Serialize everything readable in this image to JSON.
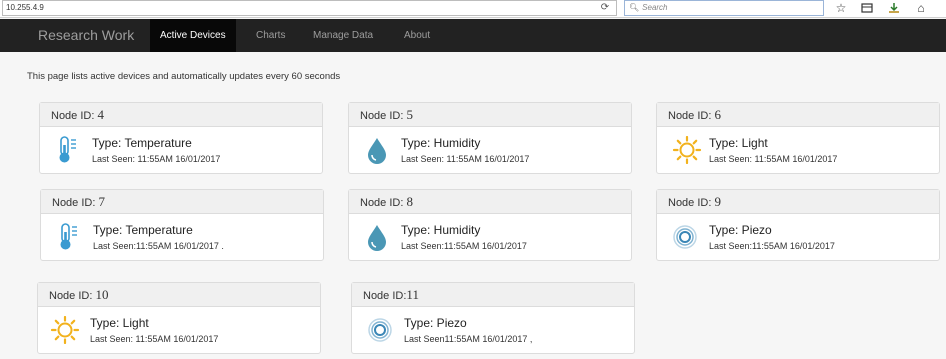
{
  "browser": {
    "url": "10.255.4.9",
    "search_placeholder": "Search"
  },
  "nav": {
    "brand": "Research Work",
    "items": [
      {
        "label": "Active Devices",
        "active": true
      },
      {
        "label": "Charts",
        "active": false
      },
      {
        "label": "Manage Data",
        "active": false
      },
      {
        "label": "About",
        "active": false
      }
    ]
  },
  "intro": "This page lists active devices and automatically updates every 60 seconds",
  "devices": [
    {
      "node_label": "Node ID:",
      "node_id": "4",
      "type": "Type: Temperature",
      "last_seen": "Last Seen: 11:55AM 16/01/2017",
      "icon": "thermometer-icon"
    },
    {
      "node_label": "Node ID:",
      "node_id": "5",
      "type": "Type: Humidity",
      "last_seen": "Last Seen: 11:55AM 16/01/2017",
      "icon": "water-drop-icon"
    },
    {
      "node_label": "Node ID:",
      "node_id": "6",
      "type": "Type: Light",
      "last_seen": "Last Seen: 11:55AM 16/01/2017",
      "icon": "sun-icon"
    },
    {
      "node_label": "Node ID:",
      "node_id": "7",
      "type": "Type: Temperature",
      "last_seen": "Last Seen:11:55AM 16/01/2017 .",
      "icon": "thermometer-icon"
    },
    {
      "node_label": "Node ID:",
      "node_id": "8",
      "type": "Type: Humidity",
      "last_seen": "Last Seen:11:55AM 16/01/2017",
      "icon": "water-drop-icon"
    },
    {
      "node_label": "Node ID:",
      "node_id": "9",
      "type": "Type: Piezo",
      "last_seen": "Last Seen:11:55AM 16/01/2017",
      "icon": "piezo-icon"
    },
    {
      "node_label": "Node ID:",
      "node_id": "10",
      "type": "Type: Light",
      "last_seen": "Last Seen: 11:55AM 16/01/2017",
      "icon": "sun-icon"
    },
    {
      "node_label": "Node ID:",
      "node_id": "11",
      "type": "Type: Piezo",
      "last_seen": "Last Seen11:55AM 16/01/2017 ,",
      "icon": "piezo-icon"
    }
  ],
  "colors": {
    "navbar": "#222222",
    "icon_blue": "#3a9bd1",
    "icon_sun": "#f2b21d",
    "humidity_blue": "#4a97b5"
  }
}
